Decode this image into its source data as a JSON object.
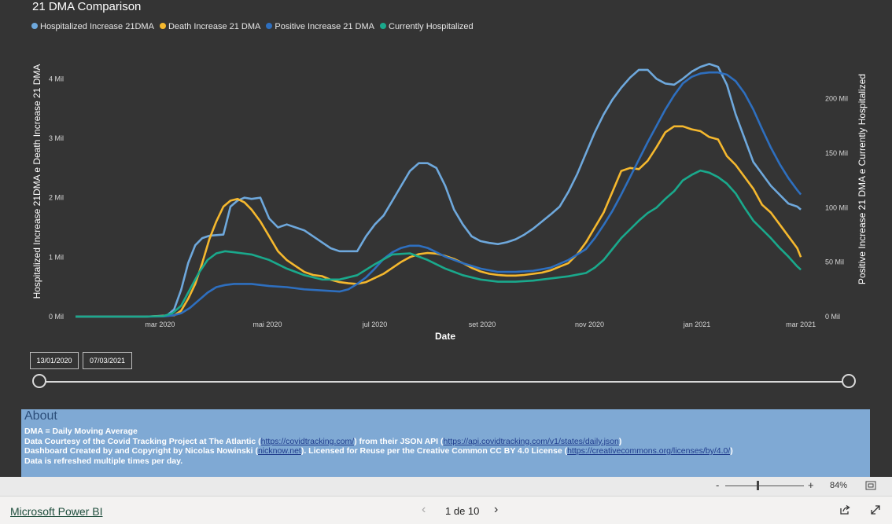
{
  "chart_title": "21 DMA Comparison",
  "legend": [
    {
      "label": "Hospitalized Increase 21DMA",
      "color": "#6ea8dc"
    },
    {
      "label": "Death Increase 21 DMA",
      "color": "#f5b82e"
    },
    {
      "label": "Positive Increase 21 DMA",
      "color": "#2e6fbf"
    },
    {
      "label": "Currently Hospitalized",
      "color": "#1aa98c"
    }
  ],
  "chart_data": {
    "type": "line",
    "xlabel": "Date",
    "ylabel_left": "Hospitalized Increase 21DMA e Death Increase 21 DMA",
    "ylabel_right": "Positive Increase 21 DMA e Currently Hospitalized",
    "x_ticks": [
      "mar 2020",
      "mai 2020",
      "jul 2020",
      "set 2020",
      "nov 2020",
      "jan 2021",
      "mar 2021"
    ],
    "x_tick_days": [
      48,
      109,
      170,
      231,
      292,
      353,
      412
    ],
    "left_ticks": [
      "0 Mil",
      "1 Mil",
      "2 Mil",
      "3 Mil",
      "4 Mil"
    ],
    "right_ticks": [
      "0 Mil",
      "50 Mil",
      "100 Mil",
      "150 Mil",
      "200 Mil"
    ],
    "left_ylim": [
      0,
      4.4
    ],
    "right_ylim": [
      0,
      240
    ],
    "x_range_days": [
      0,
      420
    ],
    "series": [
      {
        "name": "Hospitalized Increase 21DMA",
        "axis": "left",
        "color": "#6ea8dc",
        "x": [
          0,
          40,
          52,
          56,
          60,
          64,
          68,
          72,
          76,
          80,
          84,
          88,
          92,
          96,
          100,
          105,
          110,
          115,
          120,
          125,
          130,
          135,
          140,
          145,
          150,
          155,
          160,
          165,
          170,
          175,
          180,
          185,
          190,
          195,
          200,
          205,
          210,
          215,
          220,
          225,
          230,
          235,
          240,
          245,
          250,
          255,
          260,
          265,
          270,
          275,
          280,
          285,
          290,
          295,
          300,
          305,
          310,
          315,
          320,
          325,
          330,
          335,
          340,
          345,
          350,
          355,
          360,
          365,
          370,
          375,
          380,
          385,
          390,
          395,
          400,
          405,
          410,
          412
        ],
        "y": [
          0,
          0,
          0.02,
          0.12,
          0.45,
          0.9,
          1.2,
          1.32,
          1.36,
          1.37,
          1.38,
          1.85,
          1.95,
          2.0,
          1.98,
          2.0,
          1.65,
          1.5,
          1.55,
          1.5,
          1.45,
          1.35,
          1.25,
          1.15,
          1.1,
          1.1,
          1.1,
          1.35,
          1.55,
          1.7,
          1.95,
          2.2,
          2.45,
          2.58,
          2.58,
          2.5,
          2.2,
          1.8,
          1.55,
          1.35,
          1.27,
          1.24,
          1.22,
          1.25,
          1.3,
          1.38,
          1.48,
          1.6,
          1.72,
          1.85,
          2.1,
          2.4,
          2.75,
          3.1,
          3.4,
          3.65,
          3.85,
          4.02,
          4.15,
          4.15,
          4.0,
          3.92,
          3.9,
          4.0,
          4.12,
          4.2,
          4.25,
          4.2,
          3.9,
          3.4,
          3.0,
          2.6,
          2.4,
          2.2,
          2.05,
          1.9,
          1.85,
          1.8
        ]
      },
      {
        "name": "Death Increase 21 DMA",
        "axis": "left",
        "color": "#f5b82e",
        "x": [
          0,
          40,
          56,
          60,
          64,
          68,
          72,
          76,
          80,
          84,
          88,
          92,
          96,
          100,
          105,
          110,
          115,
          120,
          125,
          130,
          135,
          140,
          145,
          150,
          155,
          160,
          165,
          170,
          175,
          180,
          185,
          190,
          195,
          200,
          205,
          210,
          215,
          220,
          225,
          230,
          235,
          240,
          245,
          250,
          255,
          260,
          265,
          270,
          275,
          280,
          285,
          290,
          295,
          300,
          305,
          310,
          315,
          320,
          325,
          330,
          335,
          340,
          345,
          350,
          355,
          360,
          365,
          370,
          375,
          380,
          385,
          390,
          395,
          400,
          405,
          410,
          412
        ],
        "y": [
          0,
          0,
          0.02,
          0.1,
          0.3,
          0.55,
          0.9,
          1.3,
          1.6,
          1.85,
          1.95,
          1.98,
          1.92,
          1.8,
          1.6,
          1.35,
          1.1,
          0.95,
          0.85,
          0.75,
          0.7,
          0.68,
          0.62,
          0.58,
          0.56,
          0.55,
          0.58,
          0.65,
          0.72,
          0.82,
          0.92,
          1.0,
          1.05,
          1.07,
          1.06,
          1.02,
          0.97,
          0.9,
          0.82,
          0.76,
          0.72,
          0.7,
          0.69,
          0.69,
          0.7,
          0.72,
          0.74,
          0.78,
          0.84,
          0.9,
          1.05,
          1.25,
          1.5,
          1.75,
          2.1,
          2.45,
          2.5,
          2.48,
          2.62,
          2.85,
          3.1,
          3.2,
          3.2,
          3.15,
          3.12,
          3.02,
          2.98,
          2.7,
          2.55,
          2.35,
          2.15,
          1.88,
          1.75,
          1.55,
          1.35,
          1.15,
          1.0
        ]
      },
      {
        "name": "Positive Increase 21 DMA",
        "axis": "right",
        "color": "#2e6fbf",
        "x": [
          0,
          40,
          50,
          55,
          60,
          65,
          70,
          75,
          80,
          85,
          90,
          100,
          110,
          120,
          130,
          140,
          150,
          155,
          160,
          165,
          170,
          175,
          180,
          185,
          190,
          195,
          200,
          205,
          210,
          220,
          230,
          240,
          250,
          260,
          270,
          280,
          290,
          295,
          300,
          305,
          310,
          315,
          320,
          325,
          330,
          335,
          340,
          345,
          350,
          355,
          360,
          365,
          370,
          375,
          380,
          385,
          390,
          395,
          400,
          405,
          410,
          412
        ],
        "y": [
          0,
          0,
          0.2,
          1,
          3,
          8,
          15,
          22,
          27,
          29,
          30,
          30,
          28,
          27,
          25,
          24,
          23,
          25,
          30,
          36,
          44,
          53,
          59,
          63,
          65,
          65,
          63,
          59,
          55,
          49,
          44,
          41,
          41,
          42,
          45,
          52,
          62,
          72,
          84,
          97,
          112,
          128,
          144,
          160,
          175,
          190,
          203,
          214,
          220,
          223,
          224,
          224,
          222,
          216,
          205,
          190,
          172,
          155,
          140,
          127,
          116,
          112
        ]
      },
      {
        "name": "Currently Hospitalized",
        "axis": "right",
        "color": "#1aa98c",
        "x": [
          0,
          40,
          50,
          55,
          60,
          65,
          70,
          75,
          80,
          85,
          90,
          95,
          100,
          110,
          120,
          130,
          140,
          150,
          160,
          170,
          180,
          190,
          200,
          210,
          220,
          230,
          240,
          250,
          260,
          270,
          280,
          290,
          295,
          300,
          305,
          310,
          315,
          320,
          325,
          330,
          335,
          340,
          345,
          350,
          355,
          360,
          365,
          370,
          375,
          380,
          385,
          390,
          395,
          400,
          405,
          410,
          412
        ],
        "y": [
          0,
          0,
          0.5,
          3,
          10,
          25,
          40,
          52,
          58,
          60,
          59,
          58,
          57,
          52,
          44,
          38,
          34,
          34,
          38,
          48,
          57,
          58,
          52,
          44,
          38,
          34,
          32,
          32,
          33,
          35,
          37,
          40,
          45,
          52,
          62,
          72,
          80,
          88,
          95,
          100,
          108,
          115,
          125,
          130,
          134,
          132,
          128,
          122,
          113,
          100,
          88,
          80,
          72,
          63,
          55,
          46,
          43
        ]
      }
    ]
  },
  "date_range": {
    "start": "13/01/2020",
    "end": "07/03/2021"
  },
  "about": {
    "title": "About",
    "line1": "DMA = Daily Moving Average",
    "line2_pre": "Data Courtesy of the Covid Tracking Project at The Atlantic (",
    "line2_link1": "https://covidtracking.com/",
    "line2_mid": ") from their JSON API (",
    "line2_link2": "https://api.covidtracking.com/v1/states/daily.json",
    "line2_post": ")",
    "line3_pre": "Dashboard Created by and Copyright by Nicolas Nowinski (",
    "line3_link1": "nicknow.net",
    "line3_mid": "). Licensed for Reuse per the Creative Common CC BY 4.0 License (",
    "line3_link2": "https://creativecommons.org/licenses/by/4.0/",
    "line3_post": ")",
    "line4": "Data is refreshed multiple times per day."
  },
  "zoom": {
    "minus": "-",
    "plus": "+",
    "level": "84%"
  },
  "footer": {
    "brand": "Microsoft Power BI",
    "page_indicator": "1 de 10",
    "prev_icon": "chevron-left-icon",
    "next_icon": "chevron-right-icon",
    "share_icon": "share-icon",
    "expand_icon": "expand-icon"
  }
}
